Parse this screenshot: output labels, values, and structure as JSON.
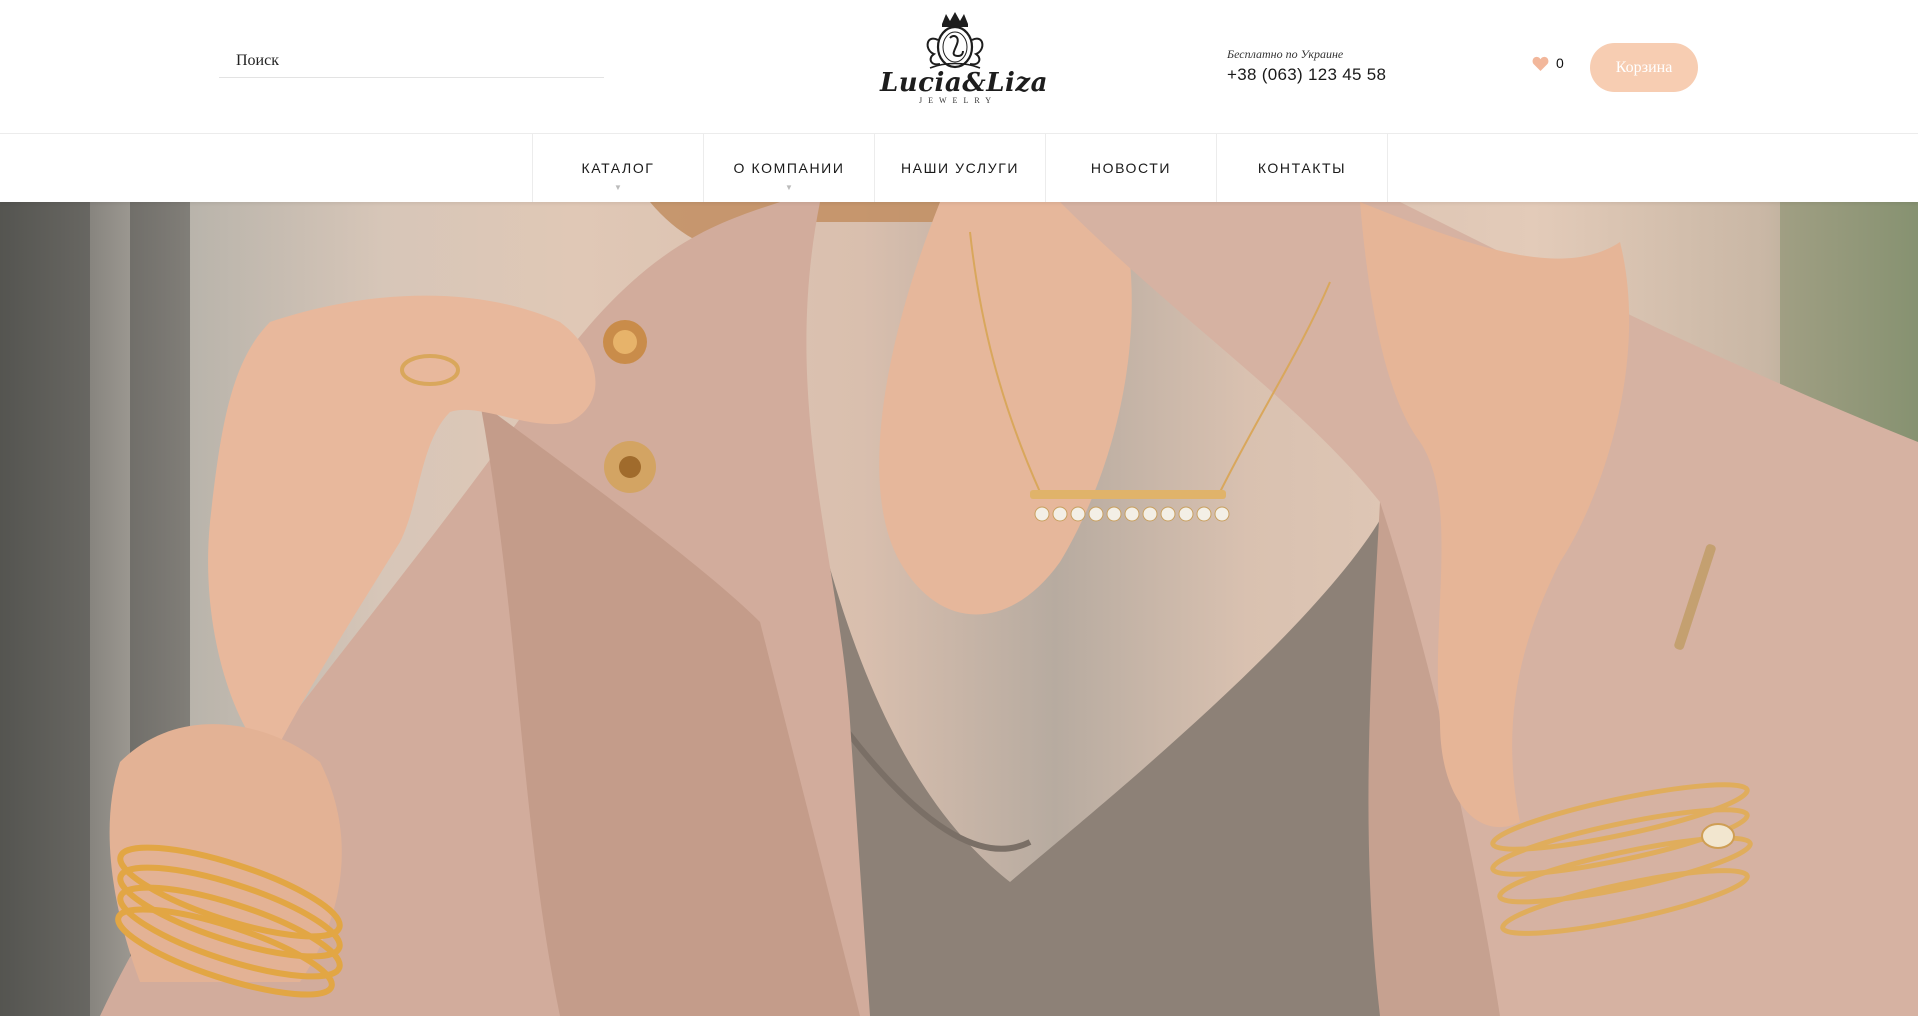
{
  "search": {
    "placeholder": "Поиск"
  },
  "logo": {
    "name": "Lucia&Liza",
    "sub": "JEWELRY"
  },
  "contact": {
    "note": "Бесплатно по Украине",
    "phone": "+38 (063) 123 45 58"
  },
  "wishlist": {
    "count": "0",
    "icon": "heart-icon"
  },
  "cart": {
    "label": "Корзина"
  },
  "nav": {
    "items": [
      {
        "label": "КАТАЛОГ",
        "has_submenu": true
      },
      {
        "label": "О КОМПАНИИ",
        "has_submenu": true
      },
      {
        "label": "НАШИ УСЛУГИ",
        "has_submenu": false
      },
      {
        "label": "НОВОСТИ",
        "has_submenu": false
      },
      {
        "label": "КОНТАКТЫ",
        "has_submenu": false
      }
    ],
    "caret": "▼"
  },
  "colors": {
    "accent": "#f7cdb2",
    "heart": "#f2b79b",
    "text": "#1a1a1a"
  }
}
